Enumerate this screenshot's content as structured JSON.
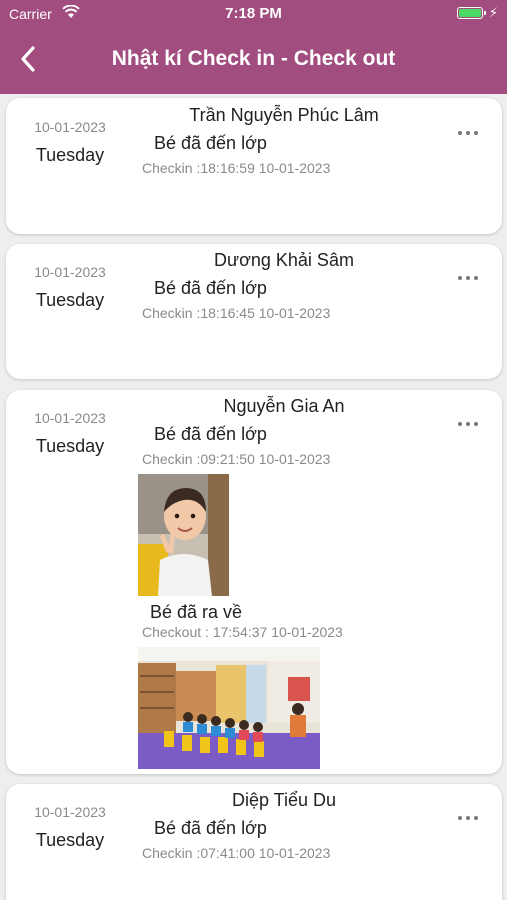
{
  "status_bar": {
    "carrier": "Carrier",
    "time": "7:18 PM"
  },
  "header": {
    "title": "Nhật kí Check in - Check out",
    "back_icon": "chevron-left-icon"
  },
  "colors": {
    "header_bg": "#a24d7f",
    "battery": "#4cd964"
  },
  "entries": [
    {
      "date": "10-01-2023",
      "weekday": "Tuesday",
      "name": "Trần Nguyễn Phúc Lâm",
      "checkin_status": "Bé đã đến lớp",
      "checkin_time": "Checkin :18:16:59 10-01-2023"
    },
    {
      "date": "10-01-2023",
      "weekday": "Tuesday",
      "name": "Dương Khải Sâm",
      "checkin_status": "Bé đã đến lớp",
      "checkin_time": "Checkin :18:16:45 10-01-2023"
    },
    {
      "date": "10-01-2023",
      "weekday": "Tuesday",
      "name": "Nguyễn Gia An",
      "checkin_status": "Bé đã đến lớp",
      "checkin_time": "Checkin :09:21:50 10-01-2023",
      "checkout_status": "Bé đã ra về",
      "checkout_time": "Checkout : 17:54:37 10-01-2023"
    },
    {
      "date": "10-01-2023",
      "weekday": "Tuesday",
      "name": "Diệp Tiểu Du",
      "checkin_status": "Bé đã đến lớp",
      "checkin_time": "Checkin :07:41:00 10-01-2023"
    }
  ]
}
